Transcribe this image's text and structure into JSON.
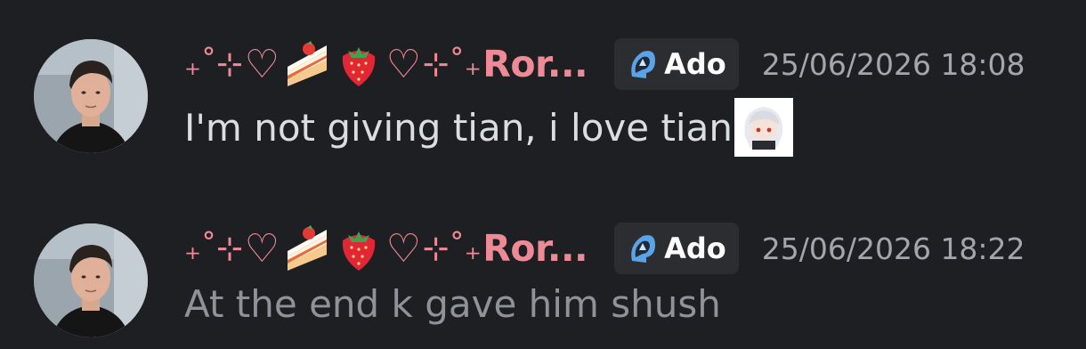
{
  "messages": [
    {
      "username_prefix": "₊˚⊹",
      "username_suffix": "⊹˚₊",
      "username_text": "Ror...",
      "role_tag": "Ado",
      "timestamp": "25/06/2026 18:08",
      "content": "I'm not giving tian, i love tian",
      "has_sticker": true,
      "faded": false
    },
    {
      "username_prefix": "₊˚⊹",
      "username_suffix": "⊹˚₊",
      "username_text": "Ror...",
      "role_tag": "Ado",
      "timestamp": "25/06/2026 18:22",
      "content": "At the end k gave him shush",
      "has_sticker": false,
      "faded": true
    }
  ],
  "icons": {
    "heart": "♡",
    "cake": "cake-emoji",
    "strawberry": "strawberry-emoji",
    "role": "ado-role-icon"
  },
  "colors": {
    "background": "#1e1f22",
    "username": "#ee8a95",
    "role_tag_bg": "#2b2d31",
    "timestamp": "#a4a6ad",
    "message_text": "#dbdee1",
    "message_text_faded": "#8f9299"
  }
}
